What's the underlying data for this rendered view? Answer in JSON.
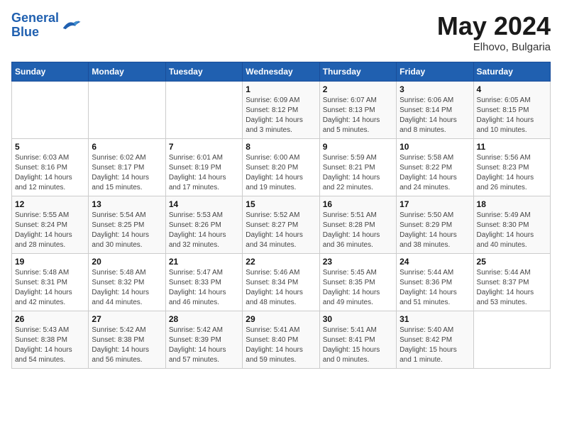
{
  "header": {
    "logo_line1": "General",
    "logo_line2": "Blue",
    "month_title": "May 2024",
    "location": "Elhovo, Bulgaria"
  },
  "weekdays": [
    "Sunday",
    "Monday",
    "Tuesday",
    "Wednesday",
    "Thursday",
    "Friday",
    "Saturday"
  ],
  "weeks": [
    [
      {
        "day": "",
        "info": ""
      },
      {
        "day": "",
        "info": ""
      },
      {
        "day": "",
        "info": ""
      },
      {
        "day": "1",
        "info": "Sunrise: 6:09 AM\nSunset: 8:12 PM\nDaylight: 14 hours\nand 3 minutes."
      },
      {
        "day": "2",
        "info": "Sunrise: 6:07 AM\nSunset: 8:13 PM\nDaylight: 14 hours\nand 5 minutes."
      },
      {
        "day": "3",
        "info": "Sunrise: 6:06 AM\nSunset: 8:14 PM\nDaylight: 14 hours\nand 8 minutes."
      },
      {
        "day": "4",
        "info": "Sunrise: 6:05 AM\nSunset: 8:15 PM\nDaylight: 14 hours\nand 10 minutes."
      }
    ],
    [
      {
        "day": "5",
        "info": "Sunrise: 6:03 AM\nSunset: 8:16 PM\nDaylight: 14 hours\nand 12 minutes."
      },
      {
        "day": "6",
        "info": "Sunrise: 6:02 AM\nSunset: 8:17 PM\nDaylight: 14 hours\nand 15 minutes."
      },
      {
        "day": "7",
        "info": "Sunrise: 6:01 AM\nSunset: 8:19 PM\nDaylight: 14 hours\nand 17 minutes."
      },
      {
        "day": "8",
        "info": "Sunrise: 6:00 AM\nSunset: 8:20 PM\nDaylight: 14 hours\nand 19 minutes."
      },
      {
        "day": "9",
        "info": "Sunrise: 5:59 AM\nSunset: 8:21 PM\nDaylight: 14 hours\nand 22 minutes."
      },
      {
        "day": "10",
        "info": "Sunrise: 5:58 AM\nSunset: 8:22 PM\nDaylight: 14 hours\nand 24 minutes."
      },
      {
        "day": "11",
        "info": "Sunrise: 5:56 AM\nSunset: 8:23 PM\nDaylight: 14 hours\nand 26 minutes."
      }
    ],
    [
      {
        "day": "12",
        "info": "Sunrise: 5:55 AM\nSunset: 8:24 PM\nDaylight: 14 hours\nand 28 minutes."
      },
      {
        "day": "13",
        "info": "Sunrise: 5:54 AM\nSunset: 8:25 PM\nDaylight: 14 hours\nand 30 minutes."
      },
      {
        "day": "14",
        "info": "Sunrise: 5:53 AM\nSunset: 8:26 PM\nDaylight: 14 hours\nand 32 minutes."
      },
      {
        "day": "15",
        "info": "Sunrise: 5:52 AM\nSunset: 8:27 PM\nDaylight: 14 hours\nand 34 minutes."
      },
      {
        "day": "16",
        "info": "Sunrise: 5:51 AM\nSunset: 8:28 PM\nDaylight: 14 hours\nand 36 minutes."
      },
      {
        "day": "17",
        "info": "Sunrise: 5:50 AM\nSunset: 8:29 PM\nDaylight: 14 hours\nand 38 minutes."
      },
      {
        "day": "18",
        "info": "Sunrise: 5:49 AM\nSunset: 8:30 PM\nDaylight: 14 hours\nand 40 minutes."
      }
    ],
    [
      {
        "day": "19",
        "info": "Sunrise: 5:48 AM\nSunset: 8:31 PM\nDaylight: 14 hours\nand 42 minutes."
      },
      {
        "day": "20",
        "info": "Sunrise: 5:48 AM\nSunset: 8:32 PM\nDaylight: 14 hours\nand 44 minutes."
      },
      {
        "day": "21",
        "info": "Sunrise: 5:47 AM\nSunset: 8:33 PM\nDaylight: 14 hours\nand 46 minutes."
      },
      {
        "day": "22",
        "info": "Sunrise: 5:46 AM\nSunset: 8:34 PM\nDaylight: 14 hours\nand 48 minutes."
      },
      {
        "day": "23",
        "info": "Sunrise: 5:45 AM\nSunset: 8:35 PM\nDaylight: 14 hours\nand 49 minutes."
      },
      {
        "day": "24",
        "info": "Sunrise: 5:44 AM\nSunset: 8:36 PM\nDaylight: 14 hours\nand 51 minutes."
      },
      {
        "day": "25",
        "info": "Sunrise: 5:44 AM\nSunset: 8:37 PM\nDaylight: 14 hours\nand 53 minutes."
      }
    ],
    [
      {
        "day": "26",
        "info": "Sunrise: 5:43 AM\nSunset: 8:38 PM\nDaylight: 14 hours\nand 54 minutes."
      },
      {
        "day": "27",
        "info": "Sunrise: 5:42 AM\nSunset: 8:38 PM\nDaylight: 14 hours\nand 56 minutes."
      },
      {
        "day": "28",
        "info": "Sunrise: 5:42 AM\nSunset: 8:39 PM\nDaylight: 14 hours\nand 57 minutes."
      },
      {
        "day": "29",
        "info": "Sunrise: 5:41 AM\nSunset: 8:40 PM\nDaylight: 14 hours\nand 59 minutes."
      },
      {
        "day": "30",
        "info": "Sunrise: 5:41 AM\nSunset: 8:41 PM\nDaylight: 15 hours\nand 0 minutes."
      },
      {
        "day": "31",
        "info": "Sunrise: 5:40 AM\nSunset: 8:42 PM\nDaylight: 15 hours\nand 1 minute."
      },
      {
        "day": "",
        "info": ""
      }
    ]
  ]
}
